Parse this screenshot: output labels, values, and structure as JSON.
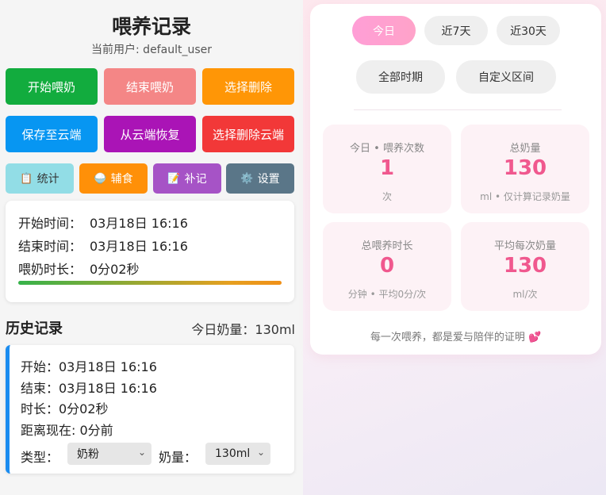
{
  "header": {
    "title": "喂养记录",
    "user": "当前用户: default_user"
  },
  "actions": {
    "start": "开始喂奶",
    "end": "结束喂奶",
    "select_delete": "选择删除",
    "save_cloud": "保存至云端",
    "restore_cloud": "从云端恢复",
    "select_delete_cloud": "选择删除云端"
  },
  "shortcuts": [
    {
      "icon": "📋",
      "label": "统计"
    },
    {
      "icon": "🍚",
      "label": "辅食"
    },
    {
      "icon": "📝",
      "label": "补记"
    },
    {
      "icon": "⚙️",
      "label": "设置"
    }
  ],
  "timer": {
    "start_label": "开始时间：",
    "start_value": "03月18日 16:16",
    "end_label": "结束时间：",
    "end_value": "03月18日 16:16",
    "duration_label": "喂奶时长：",
    "duration_value": "0分02秒",
    "progress": 1.0
  },
  "history": {
    "title": "历史记录",
    "today_milk": "今日奶量：130ml"
  },
  "record": {
    "start": "开始：03月18日 16:16",
    "end": "结束：03月18日 16:16",
    "duration": "时长：0分02秒",
    "since": "距离现在: 0分前",
    "type_label": "类型：",
    "type_value": "奶粉",
    "amount_label": "奶量：",
    "amount_value": "130ml"
  },
  "stats_panel": {
    "ranges": [
      "今日",
      "近7天",
      "近30天",
      "全部时期",
      "自定义区间"
    ],
    "active_range": "今日",
    "cards": [
      {
        "label": "今日 • 喂养次数",
        "value": "1",
        "unit": "次"
      },
      {
        "label": "总奶量",
        "value": "130",
        "unit": "ml • 仅计算记录奶量"
      },
      {
        "label": "总喂养时长",
        "value": "0",
        "unit": "分钟 • 平均0分/次"
      },
      {
        "label": "平均每次奶量",
        "value": "130",
        "unit": "ml/次"
      }
    ],
    "footer": "每一次喂养，都是爱与陪伴的证明 💕"
  },
  "colors": {
    "accent_pink": "#f0588e",
    "start_green": "#12ac3e",
    "record_border": "#1a8cf0"
  }
}
